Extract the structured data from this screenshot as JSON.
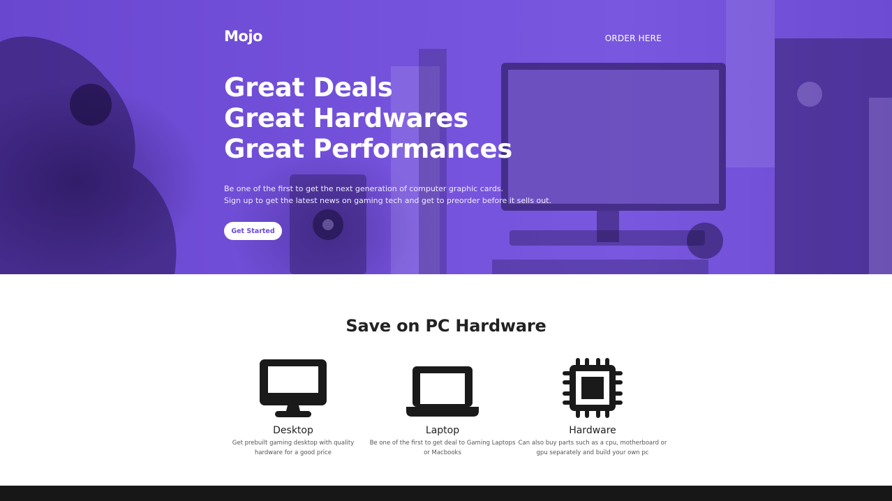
{
  "nav": {
    "brand": "Mojo",
    "order_link": "ORDER HERE"
  },
  "hero": {
    "headline": [
      "Great Deals",
      "Great Hardwares",
      "Great Performances"
    ],
    "subtext": [
      "Be one of the first to get the next generation of computer graphic cards.",
      "Sign up to get the latest news on gaming tech and get to preorder before it sells out."
    ],
    "cta_label": "Get Started",
    "overlay_color": "#7452DB"
  },
  "features": {
    "title": "Save on PC Hardware",
    "items": [
      {
        "icon": "desktop-icon",
        "title": "Desktop",
        "description": [
          "Get prebuilt gaming desktop with quality",
          "hardware for a good price"
        ]
      },
      {
        "icon": "laptop-icon",
        "title": "Laptop",
        "description": [
          "Be one of the first to get deal to Gaming Laptops",
          "or Macbooks"
        ]
      },
      {
        "icon": "cpu-chip-icon",
        "title": "Hardware",
        "description": [
          "Can also buy parts such as a cpu, motherboard or",
          "gpu separately and build your own pc"
        ]
      }
    ]
  },
  "colors": {
    "accent": "#6B49D6",
    "footer": "#171717",
    "icon": "#1A1A1A"
  }
}
